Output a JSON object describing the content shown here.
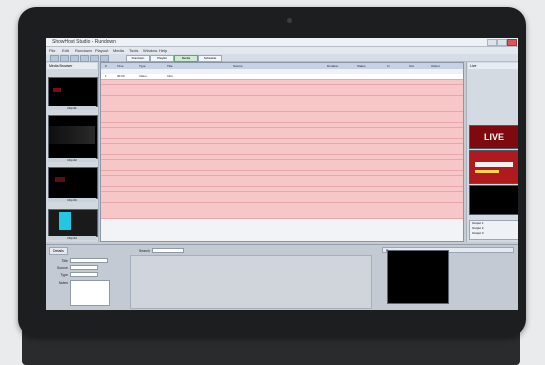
{
  "window": {
    "title": "ShowHost Studio - Rundown"
  },
  "menu": [
    "File",
    "Edit",
    "Rundown",
    "Playout",
    "Media",
    "Tools",
    "Window",
    "Help"
  ],
  "tabs": [
    "Rundown",
    "Playlist",
    "Media",
    "Schedule"
  ],
  "left_panel": {
    "title": "Media Browser",
    "thumbs": [
      "Clip 01",
      "Clip 02",
      "Clip 03",
      "Clip 04"
    ]
  },
  "grid": {
    "columns": [
      "#",
      "Time",
      "Type",
      "Title",
      "Source",
      "Duration",
      "Status",
      "In",
      "Out",
      "Owner"
    ],
    "rows": [
      {
        "type": "header"
      },
      {
        "type": "plain",
        "cells": [
          "1",
          "00:00",
          "Video",
          "Intro",
          "",
          "",
          "",
          "",
          "",
          ""
        ]
      },
      {
        "type": "pink"
      },
      {
        "type": "pink"
      },
      {
        "type": "pink"
      },
      {
        "type": "pink"
      },
      {
        "type": "pink"
      },
      {
        "type": "pink"
      },
      {
        "type": "pink"
      },
      {
        "type": "pink"
      },
      {
        "type": "pink"
      },
      {
        "type": "pink"
      },
      {
        "type": "pink"
      },
      {
        "type": "pink"
      },
      {
        "type": "pink"
      },
      {
        "type": "pink"
      },
      {
        "type": "pink"
      },
      {
        "type": "pink"
      },
      {
        "type": "pink"
      },
      {
        "type": "pink"
      },
      {
        "type": "pink"
      },
      {
        "type": "pink"
      },
      {
        "type": "pink"
      },
      {
        "type": "pink"
      },
      {
        "type": "pink"
      },
      {
        "type": "pink"
      },
      {
        "type": "pink"
      },
      {
        "type": "pink"
      }
    ]
  },
  "right_panel": {
    "title": "Live",
    "live_label": "LIVE",
    "outputs": [
      "Output 1",
      "Output 2",
      "Output 3"
    ]
  },
  "bottom": {
    "tab": "Details",
    "fields": [
      {
        "label": "Title",
        "value": ""
      },
      {
        "label": "Source",
        "value": ""
      },
      {
        "label": "Type",
        "value": ""
      },
      {
        "label": "Notes",
        "value": ""
      }
    ],
    "search_label": "Search",
    "preview_label": "Preview"
  },
  "colors": {
    "pink_row": "#f7c7c7",
    "grid_bg": "#f2f3f5",
    "live_red": "#c2121a"
  }
}
